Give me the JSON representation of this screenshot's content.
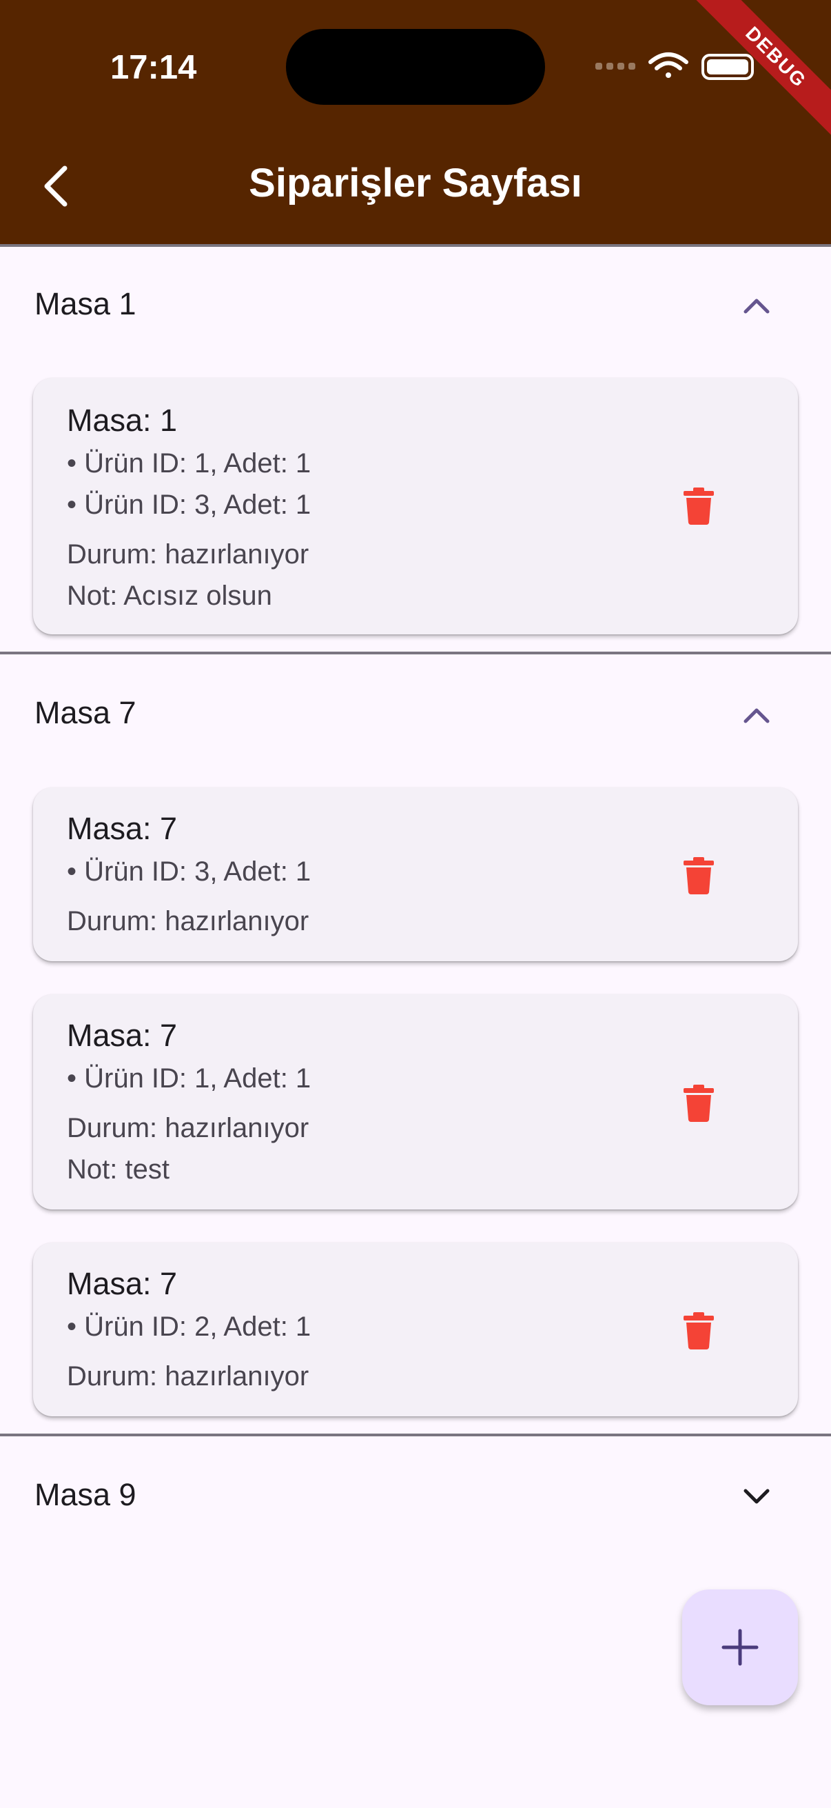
{
  "status_bar": {
    "time": "17:14",
    "debug_label": "DEBUG"
  },
  "header": {
    "title": "Siparişler Sayfası",
    "back_icon": "chevron-left-icon"
  },
  "groups": [
    {
      "title": "Masa 1",
      "expanded": true,
      "orders": [
        {
          "title": "Masa: 1",
          "items": [
            "• Ürün ID: 1, Adet: 1",
            "• Ürün ID: 3, Adet: 1"
          ],
          "status": "Durum: hazırlanıyor",
          "note": "Not: Acısız olsun"
        }
      ]
    },
    {
      "title": "Masa 7",
      "expanded": true,
      "orders": [
        {
          "title": "Masa: 7",
          "items": [
            "• Ürün ID: 3, Adet: 1"
          ],
          "status": "Durum: hazırlanıyor"
        },
        {
          "title": "Masa: 7",
          "items": [
            "• Ürün ID: 1, Adet: 1"
          ],
          "status": "Durum: hazırlanıyor",
          "note": "Not: test"
        },
        {
          "title": "Masa: 7",
          "items": [
            "• Ürün ID: 2, Adet: 1"
          ],
          "status": "Durum: hazırlanıyor"
        }
      ]
    },
    {
      "title": "Masa 9",
      "expanded": false,
      "orders": []
    }
  ],
  "fab": {
    "icon": "plus-icon"
  },
  "colors": {
    "appbar": "#562500",
    "accent": "#65558f",
    "delete": "#f44336",
    "fab_bg": "#e9ddff"
  }
}
